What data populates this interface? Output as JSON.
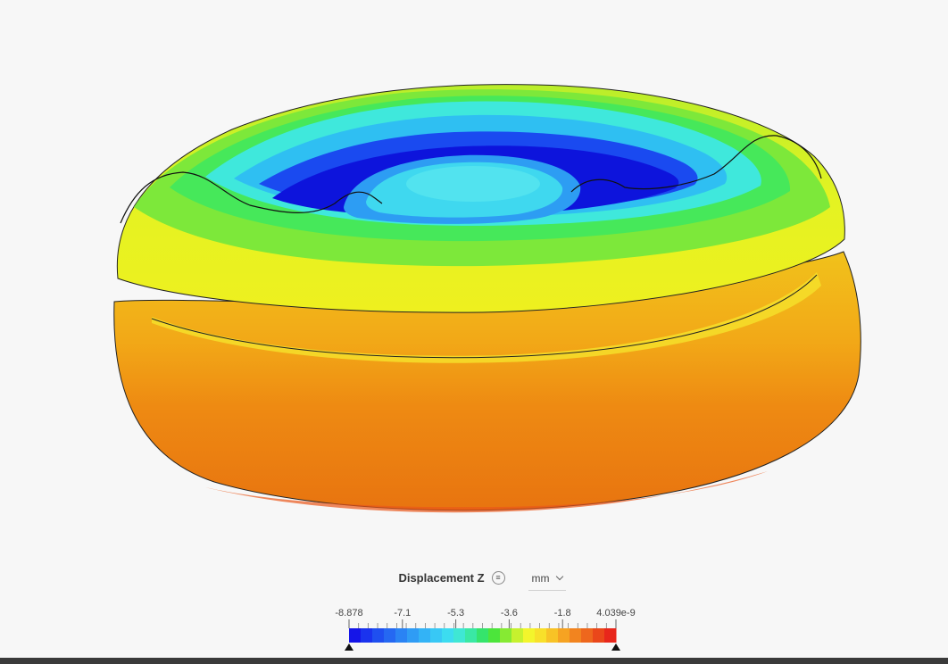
{
  "legend": {
    "title": "Displacement Z",
    "menu_icon": "list-icon",
    "unit": "mm",
    "unit_icon": "chevron-down-icon",
    "tick_labels": [
      "-8.878",
      "-7.1",
      "-5.3",
      "-3.6",
      "-1.8",
      "4.039e-9"
    ],
    "color_steps": [
      "#1515e8",
      "#1a33ee",
      "#1f4ff0",
      "#2568f2",
      "#2a83f4",
      "#2f9cf5",
      "#33b3f6",
      "#38c8f5",
      "#3cdcf0",
      "#3fe7d4",
      "#3ae8a4",
      "#35e46c",
      "#4ce53b",
      "#86ea33",
      "#c6f12e",
      "#f3f52c",
      "#f8e02a",
      "#f8c326",
      "#f6a322",
      "#f2841f",
      "#ee671d",
      "#ea471a",
      "#e8261b"
    ],
    "min_handle_icon": "triangle-up-icon",
    "max_handle_icon": "triangle-up-icon"
  },
  "model": {
    "colors": {
      "outer_bottom": "#ea7a12",
      "outer_mid": "#f2a317",
      "band_yellow": "#e9e91f",
      "band_lime": "#c7f22e",
      "band_green": "#5be83a",
      "band_cyan": "#3fe8e0",
      "band_lightblue": "#2fc6f0",
      "band_blue": "#1a3ef0",
      "band_deepblue": "#0f16df"
    }
  }
}
